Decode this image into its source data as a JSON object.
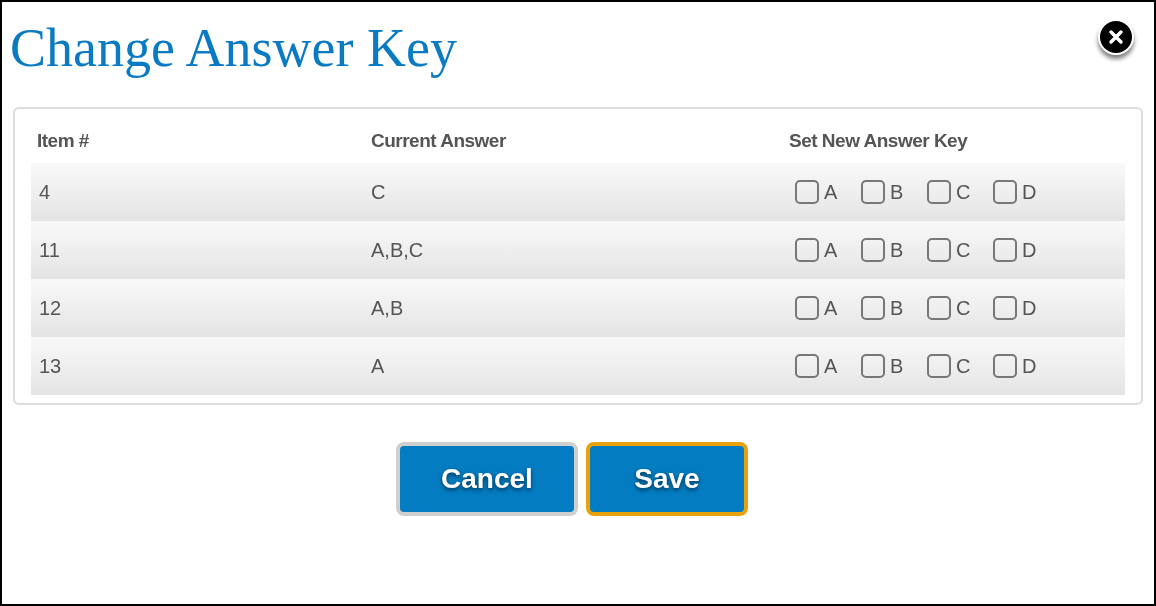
{
  "dialog": {
    "title": "Change Answer Key"
  },
  "table": {
    "columns": [
      "Item #",
      "Current Answer",
      "Set New Answer Key"
    ],
    "rows": [
      {
        "item": "4",
        "current_answer": "C",
        "options": [
          {
            "label": "A",
            "checked": false
          },
          {
            "label": "B",
            "checked": false
          },
          {
            "label": "C",
            "checked": false
          },
          {
            "label": "D",
            "checked": false
          }
        ]
      },
      {
        "item": "11",
        "current_answer": "A,B,C",
        "options": [
          {
            "label": "A",
            "checked": false
          },
          {
            "label": "B",
            "checked": false
          },
          {
            "label": "C",
            "checked": false
          },
          {
            "label": "D",
            "checked": false
          }
        ]
      },
      {
        "item": "12",
        "current_answer": "A,B",
        "options": [
          {
            "label": "A",
            "checked": false
          },
          {
            "label": "B",
            "checked": false
          },
          {
            "label": "C",
            "checked": false
          },
          {
            "label": "D",
            "checked": false
          }
        ]
      },
      {
        "item": "13",
        "current_answer": "A",
        "options": [
          {
            "label": "A",
            "checked": false
          },
          {
            "label": "B",
            "checked": false
          },
          {
            "label": "C",
            "checked": false
          },
          {
            "label": "D",
            "checked": false
          }
        ]
      }
    ]
  },
  "buttons": [
    {
      "label": "Cancel",
      "focused": false
    },
    {
      "label": "Save",
      "focused": true
    }
  ]
}
